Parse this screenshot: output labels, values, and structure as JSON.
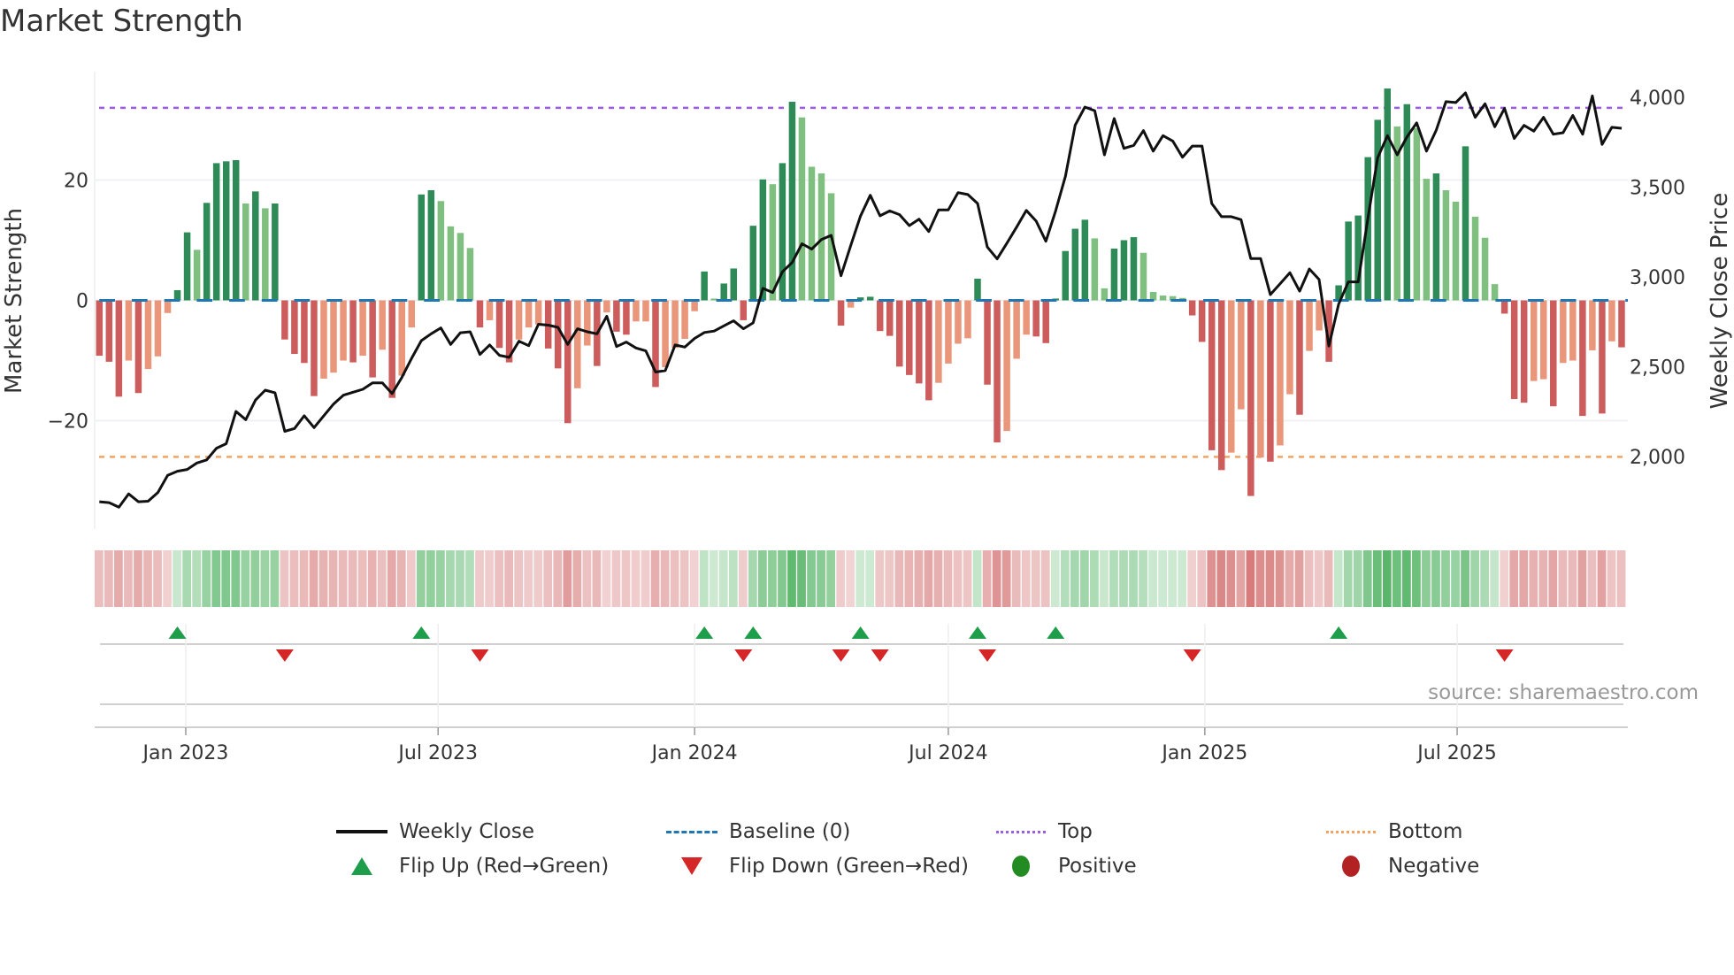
{
  "title": "Market Strength",
  "source": "source: sharemaestro.com",
  "legend": {
    "weekly_close": "Weekly Close",
    "baseline": "Baseline (0)",
    "top": "Top",
    "bottom": "Bottom",
    "flip_up": "Flip Up (Red→Green)",
    "flip_down": "Flip Down (Green→Red)",
    "positive": "Positive",
    "negative": "Negative"
  },
  "colors": {
    "pos_strong": "#2e8b57",
    "pos_weak": "#7fbf7f",
    "neg_strong": "#cd5c5c",
    "neg_weak": "#e9967a",
    "close": "#111111",
    "baseline": "#1f77b4",
    "top": "#9b5de5",
    "bottom": "#f4a261",
    "flip_up": "#1e9e4a",
    "flip_down": "#d62728",
    "positive_dot": "#228b22",
    "negative_dot": "#b22222"
  },
  "chart_data": {
    "type": "bar",
    "title": "Market Strength",
    "xlabel": "",
    "ylabel": "Market Strength",
    "ylabel_right": "Weekly Close Price",
    "x_start": "2022-10-31",
    "x_step_days": 7,
    "ylim": [
      -38,
      38
    ],
    "ylim_right": [
      1597,
      4143
    ],
    "yticks": [
      {
        "value": 20,
        "label": "20"
      },
      {
        "value": 0,
        "label": "0"
      },
      {
        "value": -20,
        "label": "−20"
      }
    ],
    "yticks_right": [
      {
        "value": 4000,
        "label": "4,000"
      },
      {
        "value": 3500,
        "label": "3,500"
      },
      {
        "value": 3000,
        "label": "3,000"
      },
      {
        "value": 2500,
        "label": "2,500"
      },
      {
        "value": 2000,
        "label": "2,000"
      }
    ],
    "xticks": [
      {
        "date": "2023-01-01",
        "label": "Jan 2023"
      },
      {
        "date": "2023-07-01",
        "label": "Jul 2023"
      },
      {
        "date": "2024-01-01",
        "label": "Jan 2024"
      },
      {
        "date": "2024-07-01",
        "label": "Jul 2024"
      },
      {
        "date": "2025-01-01",
        "label": "Jan 2025"
      },
      {
        "date": "2025-07-01",
        "label": "Jul 2025"
      }
    ],
    "top_level": 32,
    "bottom_level": -26,
    "baseline": 0,
    "grid": true,
    "legend_position": "bottom",
    "series": [
      {
        "name": "Market Strength",
        "type": "bar",
        "axis": "left",
        "values": [
          -9.2,
          -10.2,
          -16.0,
          -10.0,
          -15.4,
          -11.4,
          -9.3,
          -2.1,
          1.7,
          11.3,
          8.4,
          16.2,
          22.8,
          23.1,
          23.3,
          16.1,
          18.1,
          15.3,
          16.1,
          -6.5,
          -8.9,
          -10.4,
          -15.9,
          -13.0,
          -12.0,
          -10.0,
          -10.3,
          -9.2,
          -12.8,
          -8.2,
          -16.2,
          -12.5,
          -4.5,
          17.6,
          18.3,
          16.5,
          12.3,
          11.2,
          8.7,
          -4.5,
          -3.3,
          -7.9,
          -10.3,
          -6.5,
          -4.5,
          -4.0,
          -8.0,
          -11.3,
          -20.4,
          -14.6,
          -7.5,
          -10.9,
          -2.0,
          -5.2,
          -5.7,
          -3.5,
          -3.5,
          -14.4,
          -11.1,
          -7.9,
          -6.4,
          -1.8,
          4.8,
          0.3,
          2.8,
          5.3,
          -3.3,
          12.4,
          20.1,
          19.3,
          22.8,
          33.0,
          30.4,
          22.2,
          21.1,
          17.8,
          -4.2,
          -1.2,
          0.5,
          0.6,
          -5.1,
          -5.9,
          -11.0,
          -12.4,
          -13.8,
          -16.6,
          -13.7,
          -10.5,
          -7.2,
          -6.3,
          3.6,
          -14.0,
          -23.6,
          -21.7,
          -9.7,
          -5.7,
          -6.0,
          -7.1,
          0.3,
          8.2,
          11.9,
          13.4,
          10.3,
          2.0,
          8.6,
          10.0,
          10.5,
          7.9,
          1.4,
          0.8,
          0.7,
          0.4,
          -2.5,
          -6.9,
          -24.9,
          -28.2,
          -25.3,
          -18.1,
          -32.5,
          -26.1,
          -26.8,
          -24.1,
          -15.6,
          -19.0,
          -8.4,
          -5.0,
          -10.2,
          2.5,
          13.1,
          14.1,
          23.8,
          30.0,
          35.2,
          28.9,
          32.6,
          28.6,
          20.2,
          21.1,
          18.3,
          16.4,
          25.6,
          13.9,
          10.4,
          2.7,
          -2.2,
          -16.4,
          -17.0,
          -13.4,
          -13.1,
          -17.6,
          -10.4,
          -10.0,
          -19.2,
          -8.3,
          -18.8,
          -6.8,
          -7.8
        ]
      },
      {
        "name": "Weekly Close",
        "type": "line",
        "axis": "right",
        "values": [
          1749,
          1744,
          1719,
          1793,
          1749,
          1752,
          1801,
          1896,
          1919,
          1929,
          1965,
          1982,
          2047,
          2072,
          2252,
          2206,
          2315,
          2370,
          2356,
          2141,
          2157,
          2228,
          2162,
          2228,
          2293,
          2342,
          2359,
          2375,
          2411,
          2411,
          2351,
          2441,
          2548,
          2646,
          2684,
          2717,
          2625,
          2690,
          2695,
          2569,
          2622,
          2564,
          2553,
          2643,
          2618,
          2737,
          2732,
          2720,
          2625,
          2712,
          2695,
          2684,
          2782,
          2613,
          2638,
          2605,
          2589,
          2471,
          2479,
          2622,
          2610,
          2658,
          2691,
          2699,
          2728,
          2756,
          2712,
          2745,
          2937,
          2914,
          3029,
          3081,
          3185,
          3155,
          3209,
          3232,
          3007,
          3175,
          3339,
          3455,
          3341,
          3368,
          3347,
          3286,
          3322,
          3253,
          3374,
          3374,
          3470,
          3459,
          3409,
          3167,
          3101,
          3188,
          3278,
          3371,
          3311,
          3199,
          3368,
          3561,
          3845,
          3946,
          3926,
          3680,
          3882,
          3716,
          3733,
          3815,
          3701,
          3787,
          3757,
          3667,
          3729,
          3729,
          3409,
          3336,
          3336,
          3319,
          3103,
          3103,
          2902,
          2962,
          3024,
          2921,
          3045,
          2986,
          2616,
          2849,
          2973,
          2973,
          3327,
          3664,
          3787,
          3680,
          3779,
          3858,
          3701,
          3817,
          3976,
          3971,
          4025,
          3889,
          3964,
          3836,
          3938,
          3771,
          3844,
          3812,
          3889,
          3795,
          3803,
          3899,
          3795,
          4008,
          3738,
          3833,
          3828
        ]
      }
    ]
  }
}
